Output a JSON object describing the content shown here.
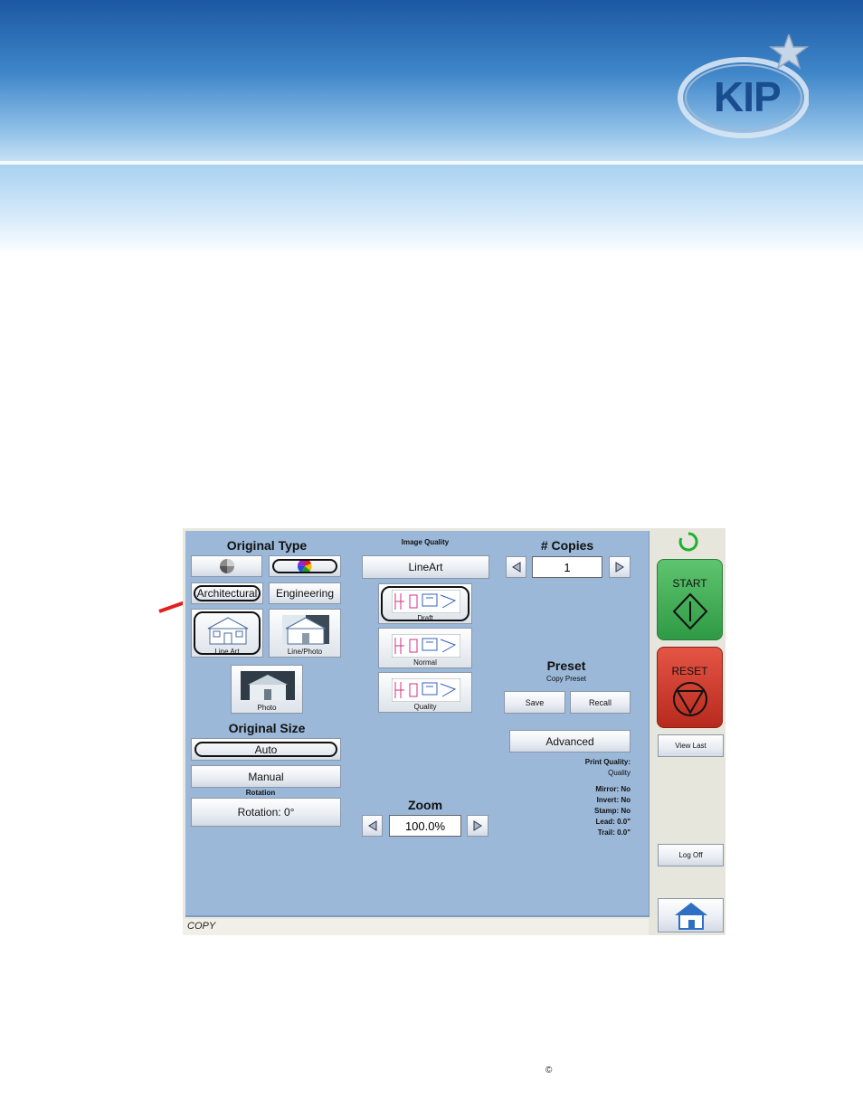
{
  "header": {
    "logo_text": "KIP"
  },
  "copy_ui": {
    "original_type": {
      "title": "Original Type",
      "architectural_label": "Architectural",
      "engineering_label": "Engineering",
      "line_art_label": "Line Art",
      "line_photo_label": "Line/Photo",
      "photo_label": "Photo"
    },
    "image_quality": {
      "title": "Image Quality",
      "mode_label": "LineArt",
      "draft_label": "Draft",
      "normal_label": "Normal",
      "quality_label": "Quality"
    },
    "copies": {
      "title": "# Copies",
      "value": "1"
    },
    "preset": {
      "title": "Preset",
      "subtitle": "Copy Preset",
      "save_label": "Save",
      "recall_label": "Recall"
    },
    "advanced_label": "Advanced",
    "print_quality": {
      "title": "Print Quality:",
      "value": "Quality"
    },
    "settings": [
      "Mirror: No",
      "Invert: No",
      "Stamp: No",
      "Lead: 0.0\"",
      "Trail: 0.0\""
    ],
    "original_size": {
      "title": "Original Size",
      "auto_label": "Auto",
      "manual_label": "Manual"
    },
    "rotation": {
      "title": "Rotation",
      "button_label": "Rotation: 0°"
    },
    "zoom": {
      "title": "Zoom",
      "value": "100.0%"
    },
    "status_bar": "COPY",
    "side": {
      "start_label": "START",
      "reset_label": "RESET",
      "view_last_label": "View Last",
      "log_off_label": "Log Off"
    }
  },
  "footer": {
    "copyright": "©"
  },
  "colors": {
    "panel": "#9bb8d8",
    "start": "#3aa350",
    "reset": "#d23a2c",
    "arrow": "#e21f1f"
  }
}
